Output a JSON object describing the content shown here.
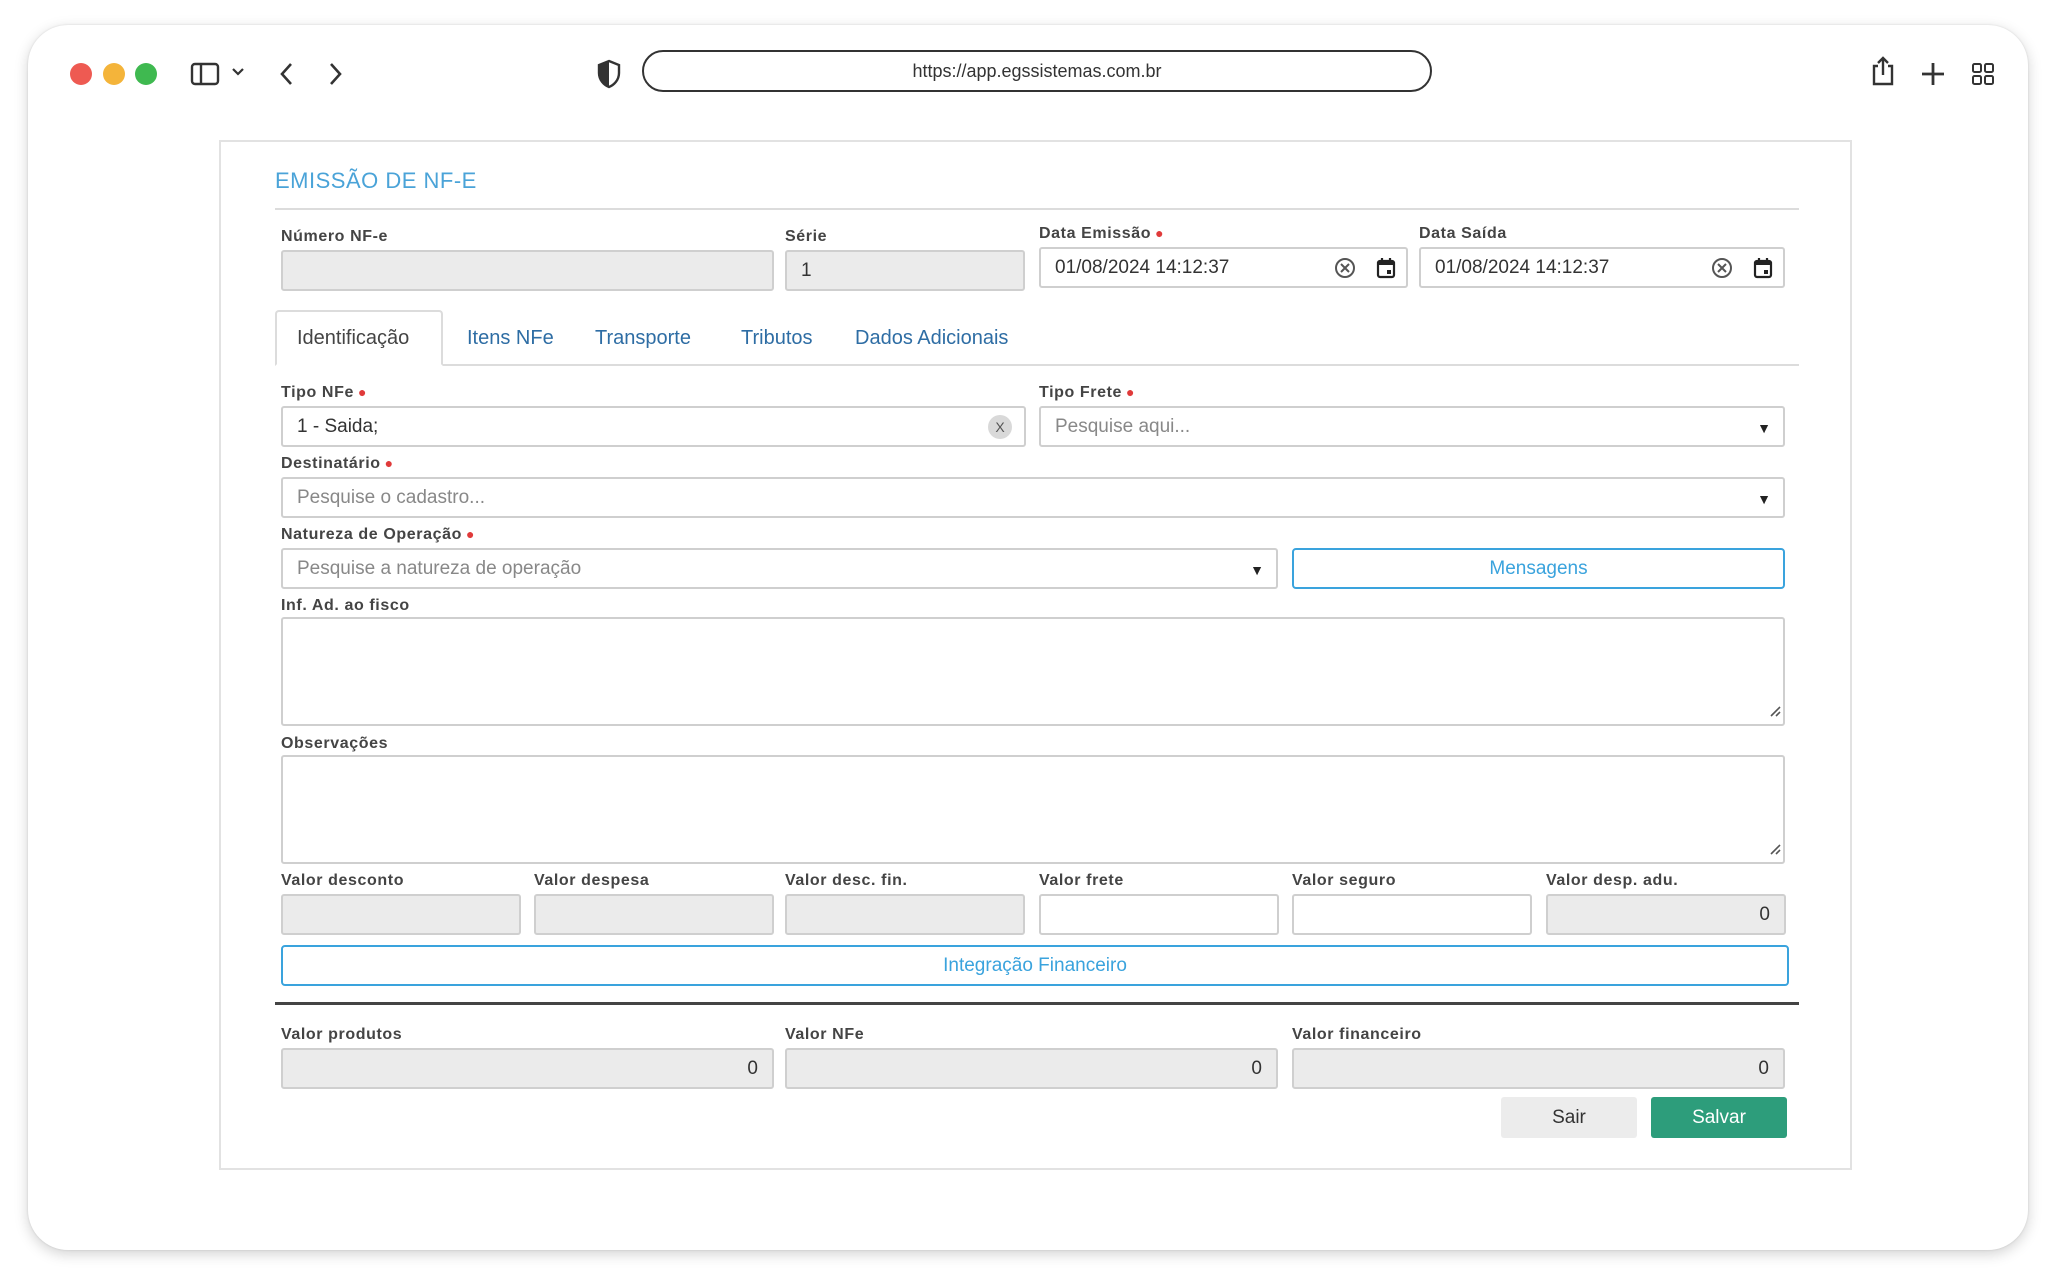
{
  "browser": {
    "url": "https://app.egssistemas.com.br",
    "icons": [
      "sidebar-icon",
      "chevron-down-icon",
      "back-icon",
      "forward-icon",
      "shield-icon",
      "share-icon",
      "new-tab-icon",
      "tab-grid-icon"
    ]
  },
  "page": {
    "title": "EMISSÃO DE NF-E"
  },
  "header_fields": {
    "numero": {
      "label": "Número NF-e",
      "value": ""
    },
    "serie": {
      "label": "Série",
      "value": "1"
    },
    "data_emissao": {
      "label": "Data Emissão",
      "value": "01/08/2024 14:12:37"
    },
    "data_saida": {
      "label": "Data Saída",
      "value": "01/08/2024 14:12:37"
    }
  },
  "tabs": [
    {
      "label": "Identificação",
      "active": true
    },
    {
      "label": "Itens NFe",
      "active": false
    },
    {
      "label": "Transporte",
      "active": false
    },
    {
      "label": "Tributos",
      "active": false
    },
    {
      "label": "Dados Adicionais",
      "active": false
    }
  ],
  "form": {
    "tipo_nfe": {
      "label": "Tipo NFe",
      "value": "1 - Saida;",
      "clear": "X"
    },
    "tipo_frete": {
      "label": "Tipo Frete",
      "placeholder": "Pesquise aqui..."
    },
    "destinatario": {
      "label": "Destinatário",
      "placeholder": "Pesquise o cadastro..."
    },
    "natureza": {
      "label": "Natureza de Operação",
      "placeholder": "Pesquise a natureza de operação"
    },
    "mensagens_button": "Mensagens",
    "inf_fisco": {
      "label": "Inf. Ad. ao fisco",
      "value": ""
    },
    "observacoes": {
      "label": "Observações",
      "value": ""
    }
  },
  "valores": {
    "desconto": {
      "label": "Valor desconto",
      "value": ""
    },
    "despesa": {
      "label": "Valor despesa",
      "value": ""
    },
    "desc_fin": {
      "label": "Valor desc. fin.",
      "value": ""
    },
    "frete": {
      "label": "Valor frete",
      "value": ""
    },
    "seguro": {
      "label": "Valor seguro",
      "value": ""
    },
    "desp_adu": {
      "label": "Valor desp. adu.",
      "value": "0"
    }
  },
  "integracao_button": "Integração Financeiro",
  "totais": {
    "produtos": {
      "label": "Valor produtos",
      "value": "0"
    },
    "nfe": {
      "label": "Valor NFe",
      "value": "0"
    },
    "financeiro": {
      "label": "Valor financeiro",
      "value": "0"
    }
  },
  "actions": {
    "exit": "Sair",
    "save": "Salvar"
  },
  "colors": {
    "accent": "#3aa3dd",
    "title": "#4aa3d8",
    "save": "#2d9d7b",
    "required": "#e03a3a"
  }
}
